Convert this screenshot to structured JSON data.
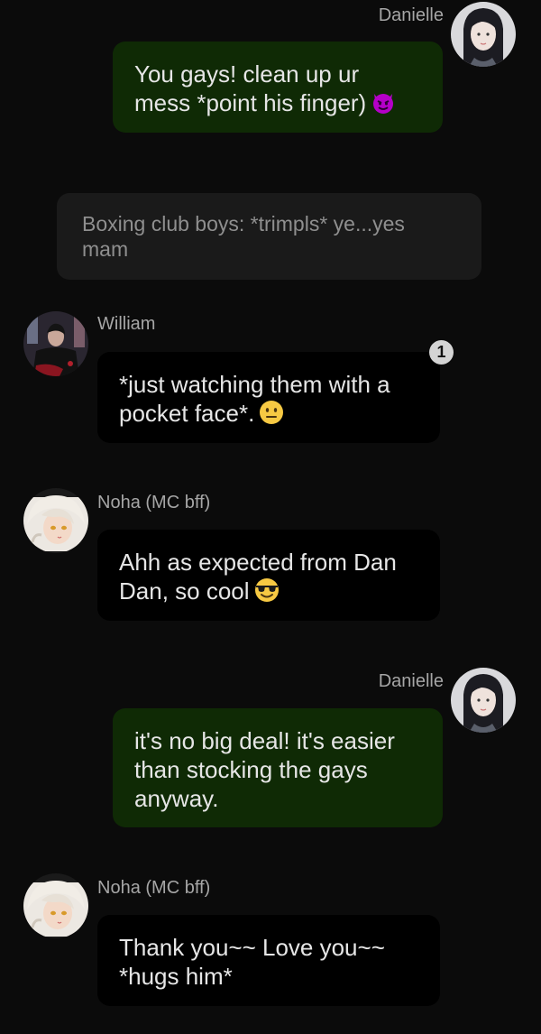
{
  "colors": {
    "background": "#0b0b0b",
    "outgoing_bubble": "#0f2a05",
    "incoming_bubble": "#000000",
    "narration_bubble": "#1a1a1a",
    "name_text": "#a6a6a6",
    "message_text": "#e6e6e6"
  },
  "messages": [
    {
      "sender": "Danielle",
      "side": "right",
      "text": "You gays! clean up ur mess *point his finger)",
      "emoji": "smiling-imp-emoji"
    },
    {
      "type": "narration",
      "text": "Boxing club boys: *trimpls* ye...yes mam"
    },
    {
      "sender": "William",
      "side": "left",
      "text": "*just watching them with a pocket  face*.",
      "emoji": "neutral-face-emoji",
      "badge": "1"
    },
    {
      "sender": "Noha (MC bff)",
      "side": "left",
      "text": "Ahh as expected from Dan Dan, so cool",
      "emoji": "sunglasses-emoji"
    },
    {
      "sender": "Danielle",
      "side": "right",
      "text": "it's no big deal! it's easier than stocking the gays anyway."
    },
    {
      "sender": "Noha (MC bff)",
      "side": "left",
      "text": "Thank you~~ Love you~~ *hugs him*"
    }
  ]
}
